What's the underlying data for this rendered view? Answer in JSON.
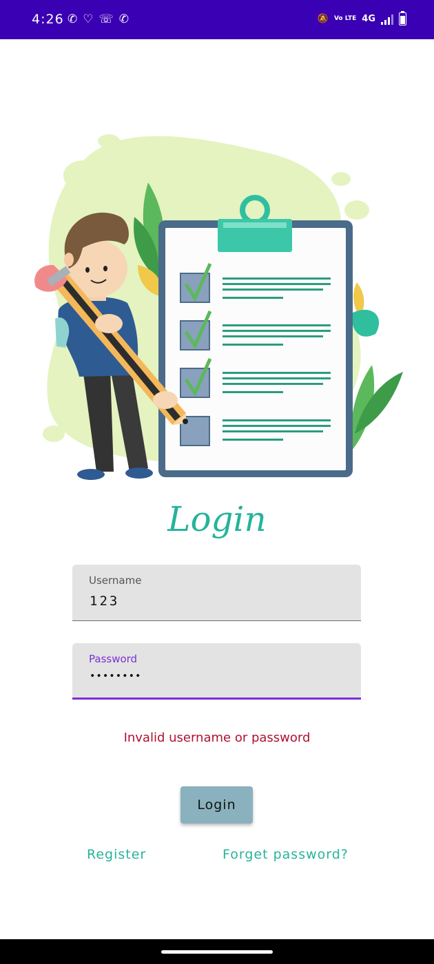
{
  "status_bar": {
    "time": "4:26",
    "left_icons": [
      "whatsapp-icon",
      "snapchat-icon",
      "missed-call-icon",
      "whatsapp-icon"
    ],
    "volte": "Vo LTE",
    "network": "4G",
    "color": "#3a00b3"
  },
  "login": {
    "title": "Login",
    "username_label": "Username",
    "username_value": "123",
    "password_label": "Password",
    "password_value": "••••••••",
    "error": "Invalid username or password",
    "button_label": "Login",
    "register_link": "Register",
    "forget_link": "Forget password?"
  },
  "colors": {
    "accent": "#26b39b",
    "error": "#b0102f",
    "focus": "#7b2fd6",
    "button": "#8ab1be"
  }
}
